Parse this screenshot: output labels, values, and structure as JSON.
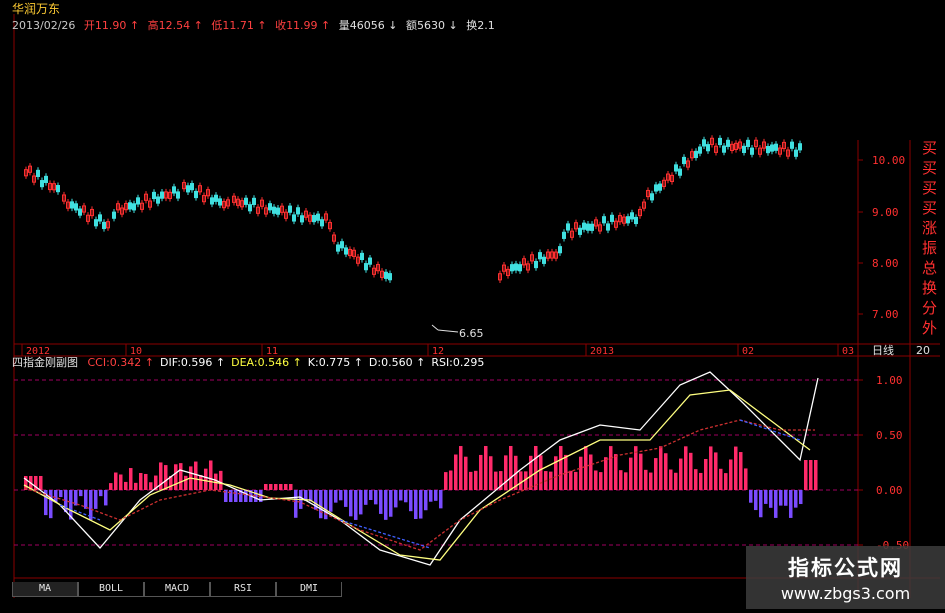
{
  "header": {
    "stock_name": "华润万东",
    "date": "2013/02/26",
    "open_label": "开",
    "open": "11.90",
    "high_label": "高",
    "high": "12.54",
    "low_label": "低",
    "low": "11.71",
    "close_label": "收",
    "close": "11.99",
    "vol_label": "量",
    "vol": "46056",
    "amt_label": "额",
    "amt": "5630",
    "turn_label": "换",
    "turn": "2.1"
  },
  "price_axis": [
    "10.00",
    "9.00",
    "8.00",
    "7.00"
  ],
  "min_price_label": "6.65",
  "time_axis": [
    "2012",
    "10",
    "11",
    "12",
    "2013",
    "02",
    "03"
  ],
  "period_label": "日线",
  "period_num": "20",
  "side_labels": [
    "买",
    "买",
    "买",
    "买",
    "涨",
    "振",
    "总",
    "换",
    "分",
    "外"
  ],
  "indicator": {
    "name": "四指金刚副图",
    "items": [
      {
        "key": "CCI",
        "val": "0.342",
        "arrow": "↑",
        "color": "#ff4040"
      },
      {
        "key": "DIF",
        "val": "0.596",
        "arrow": "↑",
        "color": "#ffffff"
      },
      {
        "key": "DEA",
        "val": "0.546",
        "arrow": "↑",
        "color": "#ffff40"
      },
      {
        "key": "K",
        "val": "0.775",
        "arrow": "↑",
        "color": "#ffffff"
      },
      {
        "key": "D",
        "val": "0.560",
        "arrow": "↑",
        "color": "#ffffff"
      },
      {
        "key": "RSI",
        "val": "0.295",
        "arrow": "",
        "color": "#ffffff"
      }
    ],
    "axis": [
      "1.00",
      "0.50",
      "0.00",
      "-0.50"
    ]
  },
  "tabs": [
    "MA",
    "BOLL",
    "MACD",
    "RSI",
    "DMI"
  ],
  "watermark": {
    "line1": "指标公式网",
    "line2": "www.zbgs3.com"
  },
  "colors": {
    "up": "#ff3030",
    "down": "#40e0e0",
    "grid": "#8a0000",
    "hist_pos": "#ff2a6a",
    "hist_neg": "#7a4cff"
  }
}
